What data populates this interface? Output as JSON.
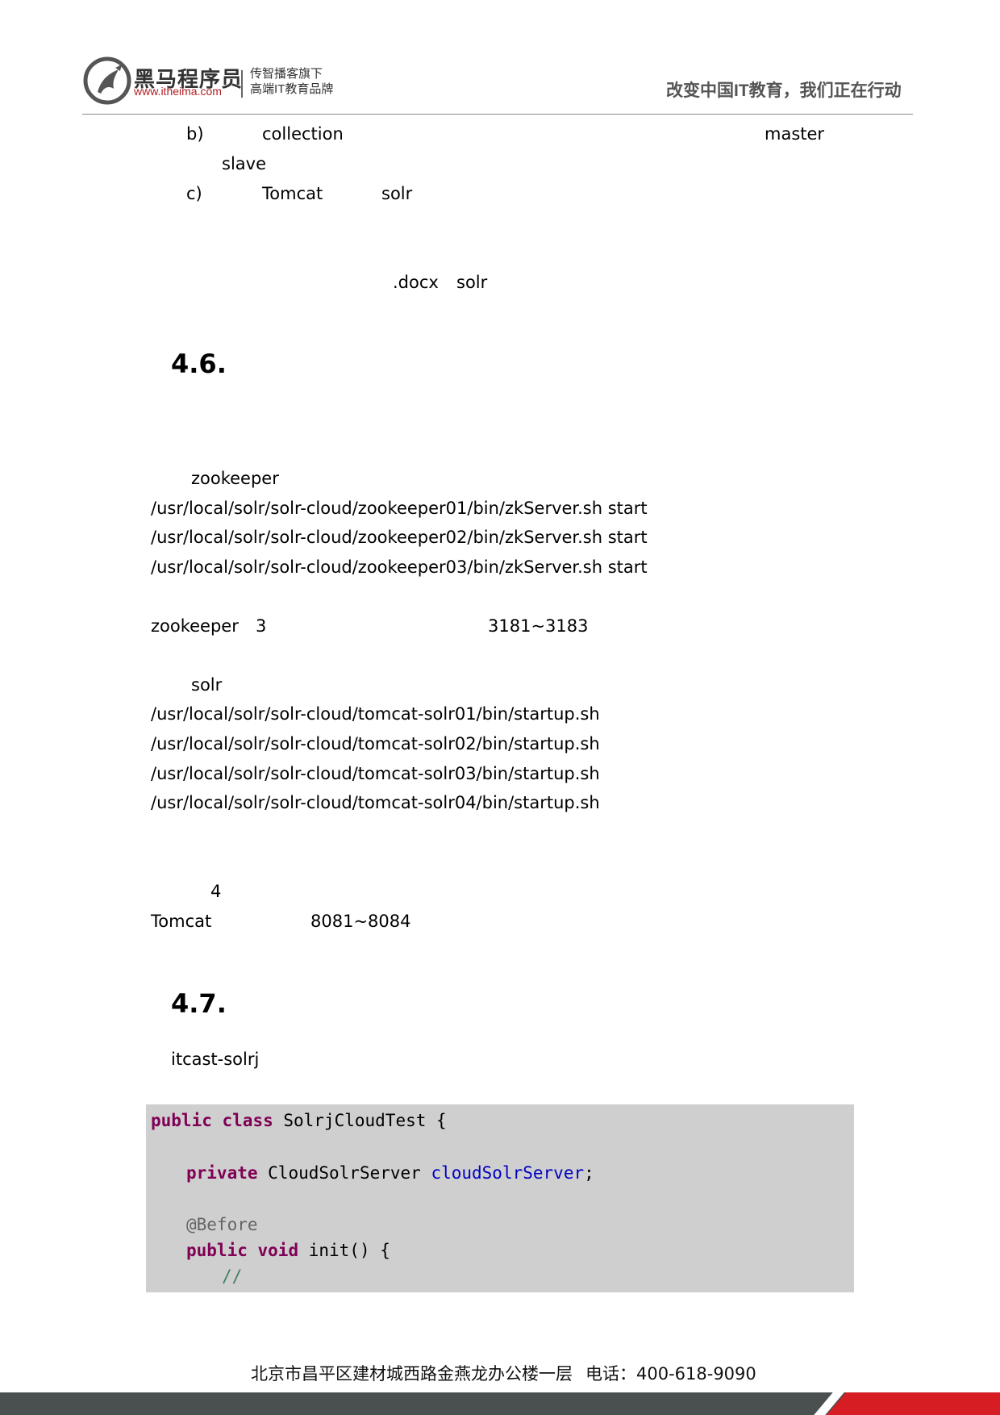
{
  "header": {
    "brand_name": "黑马程序员",
    "brand_url": "www.itheima.com",
    "brand_sub_line1": "传智播客旗下",
    "brand_sub_line2": "高端IT教育品牌",
    "slogan": "改变中国IT教育，我们正在行动"
  },
  "body": {
    "list_b_marker": "b)",
    "list_b_word": "collection",
    "list_b_word2": "master",
    "list_b_cont": "slave",
    "list_c_marker": "c)",
    "list_c_word1": "Tomcat",
    "list_c_word2": "solr",
    "docx_ref1": ".docx",
    "docx_ref2": "solr",
    "section_46": "4.6.",
    "zk_label": "zookeeper",
    "zk_cmd1": "/usr/local/solr/solr-cloud/zookeeper01/bin/zkServer.sh start",
    "zk_cmd2": "/usr/local/solr/solr-cloud/zookeeper02/bin/zkServer.sh start",
    "zk_cmd3": "/usr/local/solr/solr-cloud/zookeeper03/bin/zkServer.sh start",
    "zk_note_word": "zookeeper",
    "zk_note_count": "3",
    "zk_note_ports": "3181~3183",
    "solr_label": "solr",
    "tomcat_cmd1": "/usr/local/solr/solr-cloud/tomcat-solr01/bin/startup.sh",
    "tomcat_cmd2": "/usr/local/solr/solr-cloud/tomcat-solr02/bin/startup.sh",
    "tomcat_cmd3": "/usr/local/solr/solr-cloud/tomcat-solr03/bin/startup.sh",
    "tomcat_cmd4": "/usr/local/solr/solr-cloud/tomcat-solr04/bin/startup.sh",
    "tomcat_count": "4",
    "tomcat_word": "Tomcat",
    "tomcat_ports": "8081~8084",
    "section_47": "4.7.",
    "project_name": "itcast-solrj"
  },
  "code": {
    "l1_kw1": "public",
    "l1_kw2": "class",
    "l1_rest": " SolrjCloudTest {",
    "l2_kw": "private",
    "l2_type": " CloudSolrServer ",
    "l2_field": "cloudSolrServer",
    "l2_end": ";",
    "l3_ann": "@Before",
    "l4_kw1": "public",
    "l4_kw2": "void",
    "l4_rest": " init() {",
    "l5_cmt": "//"
  },
  "footer": {
    "address": "北京市昌平区建材城西路金燕龙办公楼一层",
    "phone": "电话：400-618-9090"
  }
}
